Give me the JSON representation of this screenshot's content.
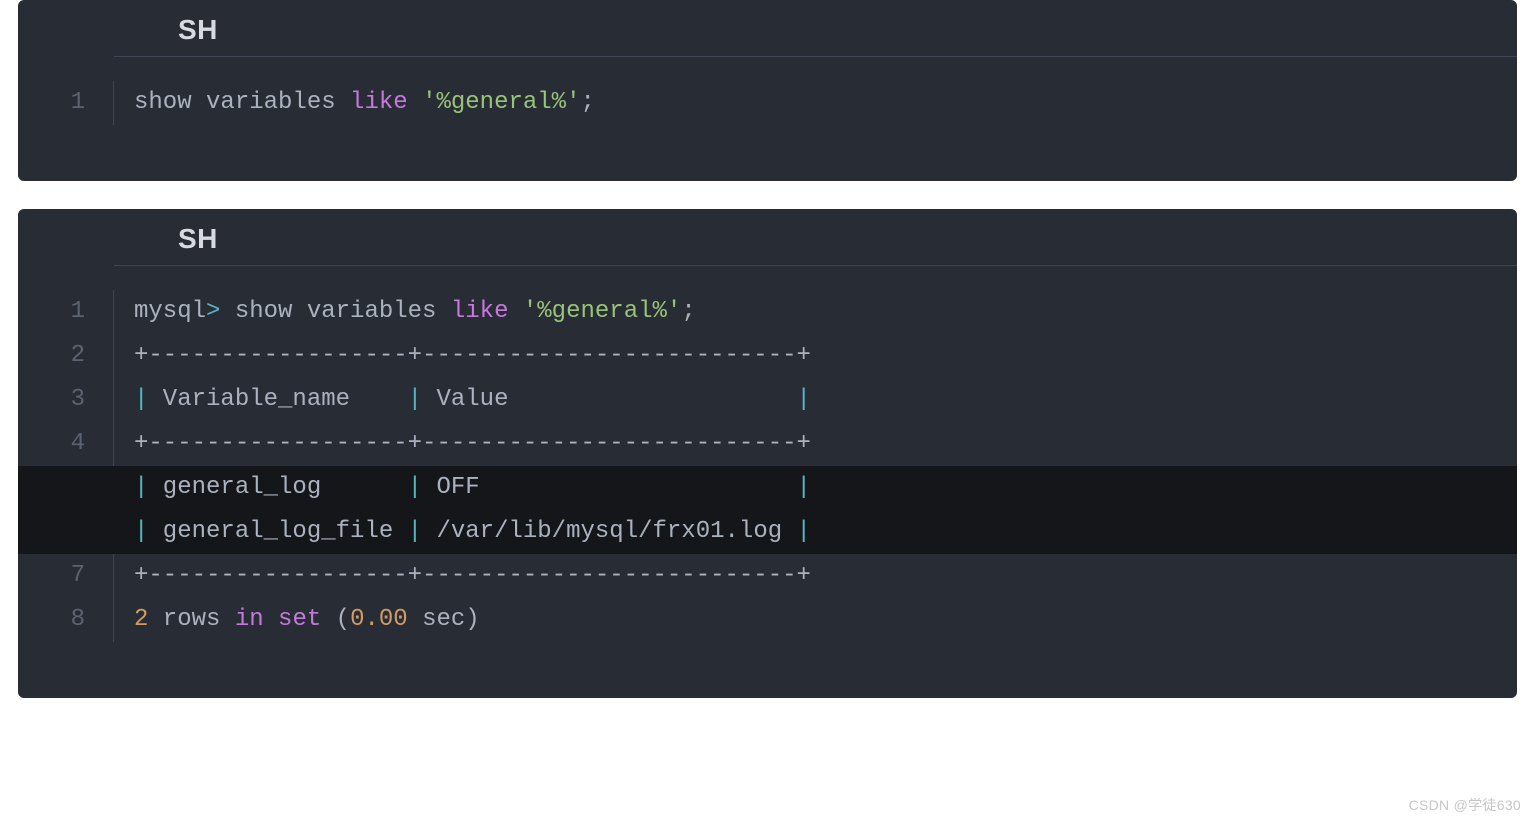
{
  "watermark": "CSDN @学徒630",
  "blocks": [
    {
      "lang_label": "SH",
      "lines": [
        {
          "hl": false,
          "tokens": [
            {
              "cls": "tok-default",
              "text": "show variables "
            },
            {
              "cls": "tok-kw",
              "text": "like"
            },
            {
              "cls": "tok-default",
              "text": " "
            },
            {
              "cls": "tok-str",
              "text": "'%general%'"
            },
            {
              "cls": "tok-punct",
              "text": ";"
            }
          ]
        }
      ]
    },
    {
      "lang_label": "SH",
      "lines": [
        {
          "hl": false,
          "tokens": [
            {
              "cls": "tok-default",
              "text": "mysql"
            },
            {
              "cls": "tok-op",
              "text": ">"
            },
            {
              "cls": "tok-default",
              "text": " show variables "
            },
            {
              "cls": "tok-kw",
              "text": "like"
            },
            {
              "cls": "tok-default",
              "text": " "
            },
            {
              "cls": "tok-str",
              "text": "'%general%'"
            },
            {
              "cls": "tok-punct",
              "text": ";"
            }
          ]
        },
        {
          "hl": false,
          "tokens": [
            {
              "cls": "tok-default",
              "text": "+------------------+--------------------------+"
            }
          ]
        },
        {
          "hl": false,
          "tokens": [
            {
              "cls": "tok-pipe",
              "text": "|"
            },
            {
              "cls": "tok-default",
              "text": " Variable_name    "
            },
            {
              "cls": "tok-pipe",
              "text": "|"
            },
            {
              "cls": "tok-default",
              "text": " Value                    "
            },
            {
              "cls": "tok-pipe",
              "text": "|"
            }
          ]
        },
        {
          "hl": false,
          "tokens": [
            {
              "cls": "tok-default",
              "text": "+------------------+--------------------------+"
            }
          ]
        },
        {
          "hl": true,
          "tokens": [
            {
              "cls": "tok-pipe",
              "text": "|"
            },
            {
              "cls": "tok-default",
              "text": " general_log      "
            },
            {
              "cls": "tok-pipe",
              "text": "|"
            },
            {
              "cls": "tok-default",
              "text": " OFF                      "
            },
            {
              "cls": "tok-pipe",
              "text": "|"
            }
          ]
        },
        {
          "hl": true,
          "tokens": [
            {
              "cls": "tok-pipe",
              "text": "|"
            },
            {
              "cls": "tok-default",
              "text": " general_log_file "
            },
            {
              "cls": "tok-pipe",
              "text": "|"
            },
            {
              "cls": "tok-default",
              "text": " /var/lib/mysql/frx01.log "
            },
            {
              "cls": "tok-pipe",
              "text": "|"
            }
          ]
        },
        {
          "hl": false,
          "tokens": [
            {
              "cls": "tok-default",
              "text": "+------------------+--------------------------+"
            }
          ]
        },
        {
          "hl": false,
          "tokens": [
            {
              "cls": "tok-num",
              "text": "2"
            },
            {
              "cls": "tok-default",
              "text": " rows "
            },
            {
              "cls": "tok-kw",
              "text": "in"
            },
            {
              "cls": "tok-default",
              "text": " "
            },
            {
              "cls": "tok-kw",
              "text": "set"
            },
            {
              "cls": "tok-default",
              "text": " "
            },
            {
              "cls": "tok-punct",
              "text": "("
            },
            {
              "cls": "tok-num",
              "text": "0.00"
            },
            {
              "cls": "tok-default",
              "text": " sec"
            },
            {
              "cls": "tok-punct",
              "text": ")"
            }
          ]
        }
      ]
    }
  ]
}
